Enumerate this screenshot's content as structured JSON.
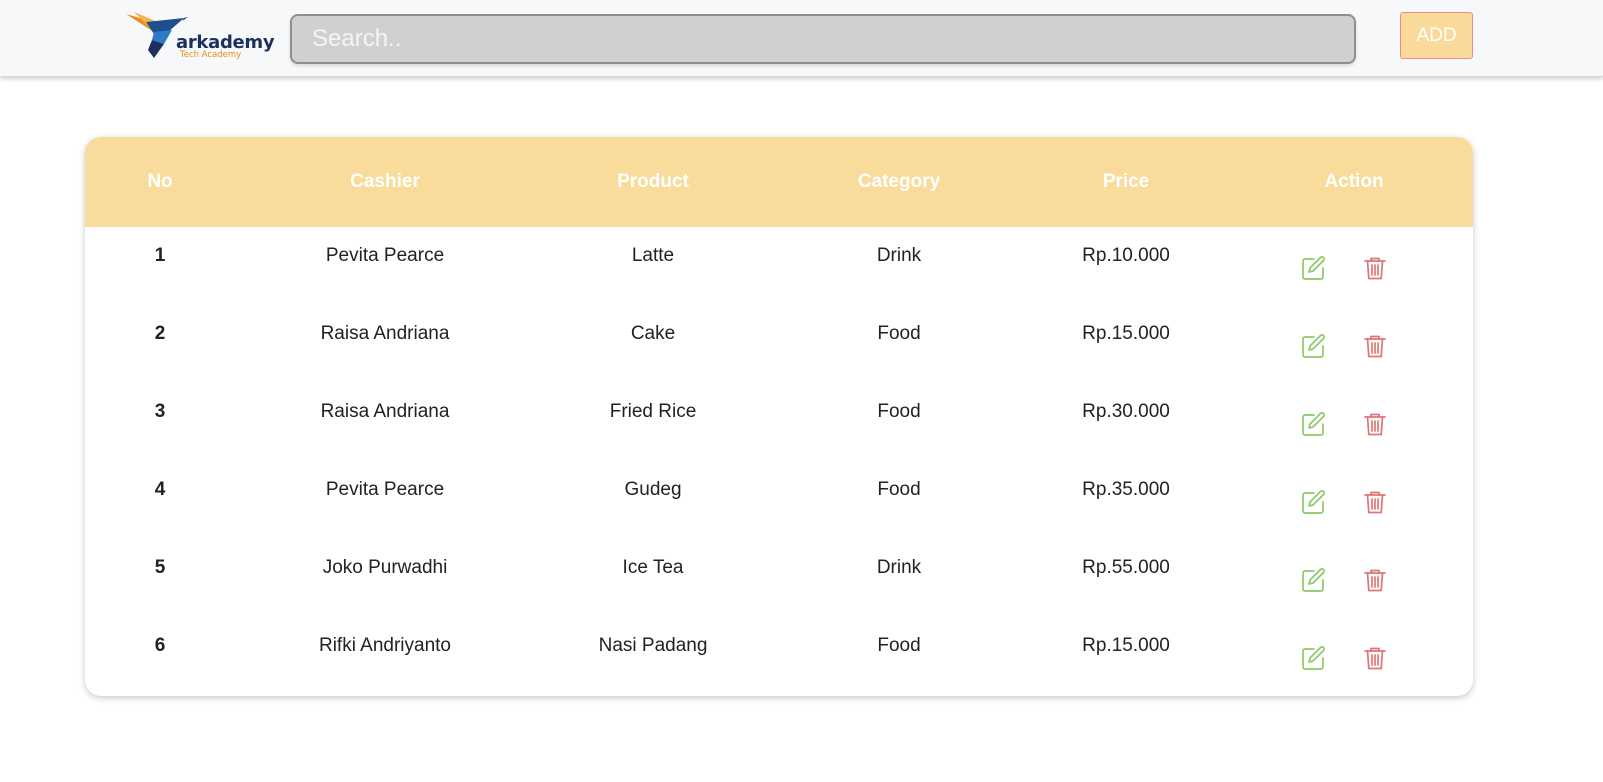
{
  "header": {
    "logo": {
      "wordmark": "arkademy",
      "tagline": "Tech Academy"
    },
    "search": {
      "placeholder": "Search..",
      "value": ""
    },
    "add_label": "ADD"
  },
  "table": {
    "columns": [
      "No",
      "Cashier",
      "Product",
      "Category",
      "Price",
      "Action"
    ],
    "rows": [
      {
        "no": "1",
        "cashier": "Pevita Pearce",
        "product": "Latte",
        "category": "Drink",
        "price": "Rp.10.000"
      },
      {
        "no": "2",
        "cashier": "Raisa Andriana",
        "product": "Cake",
        "category": "Food",
        "price": "Rp.15.000"
      },
      {
        "no": "3",
        "cashier": "Raisa Andriana",
        "product": "Fried Rice",
        "category": "Food",
        "price": "Rp.30.000"
      },
      {
        "no": "4",
        "cashier": "Pevita Pearce",
        "product": "Gudeg",
        "category": "Food",
        "price": "Rp.35.000"
      },
      {
        "no": "5",
        "cashier": "Joko Purwadhi",
        "product": "Ice Tea",
        "category": "Drink",
        "price": "Rp.55.000"
      },
      {
        "no": "6",
        "cashier": "Rifki Andriyanto",
        "product": "Nasi Padang",
        "category": "Food",
        "price": "Rp.15.000"
      }
    ],
    "actions": {
      "edit_icon": "edit-icon",
      "delete_icon": "trash-icon"
    }
  },
  "colors": {
    "header_bg": "#f9dc9b",
    "add_bg": "#f9da9a",
    "edit_icon": "#8cc96a",
    "delete_icon": "#e07575",
    "brand_navy": "#1c2f5e",
    "brand_orange": "#f08a1c"
  }
}
